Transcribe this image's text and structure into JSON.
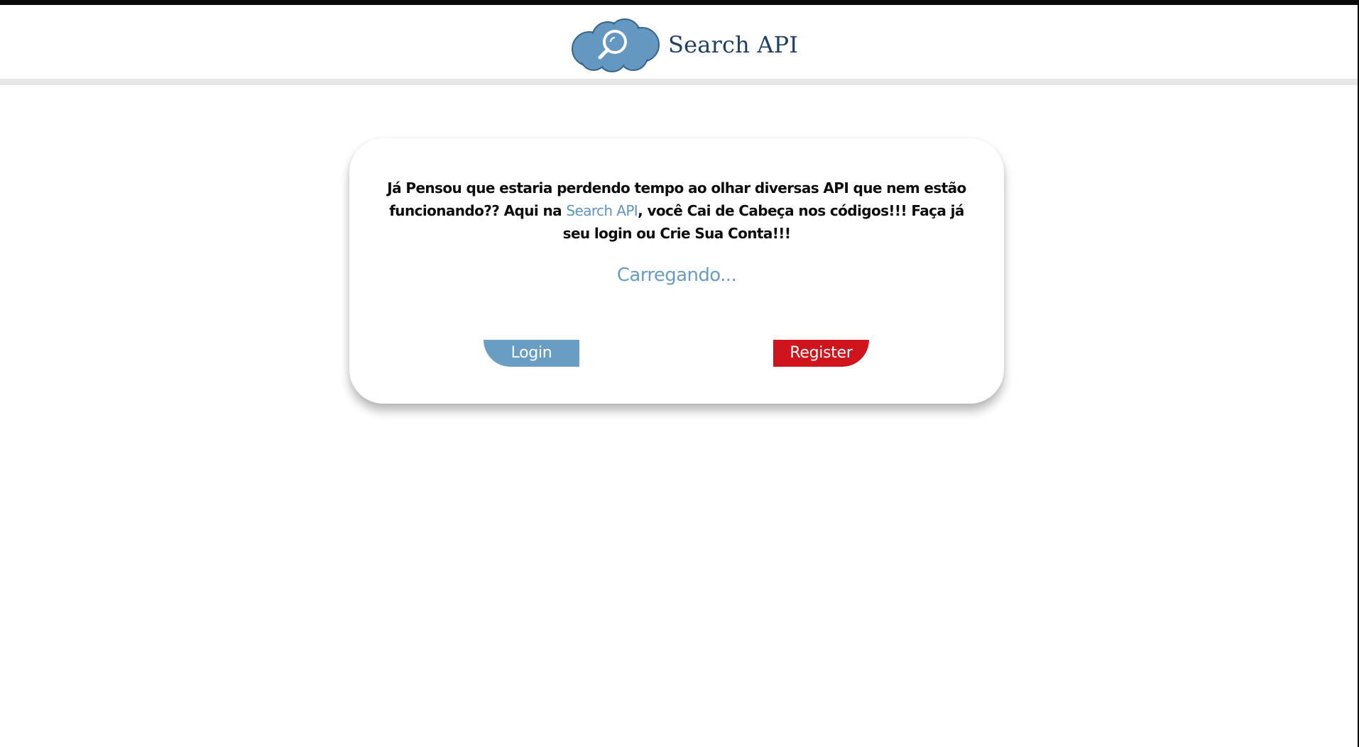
{
  "header": {
    "brand_name": "Search API",
    "logo_icon": "cloud-magnifier-icon"
  },
  "main": {
    "intro_before": "Já Pensou que estaria perdendo tempo ao olhar diversas API que nem estão funcionando?? Aqui na ",
    "intro_link": "Search API",
    "intro_after": ", você Cai de Cabeça nos códigos!!! Faça já seu login ou Crie Sua Conta!!!",
    "loading_text": "Carregando...",
    "login_label": "Login",
    "register_label": "Register"
  },
  "colors": {
    "brand_text": "#1f3f63",
    "accent_blue": "#6a9dc3",
    "register_red": "#d0141d",
    "background": "#ffffff"
  }
}
